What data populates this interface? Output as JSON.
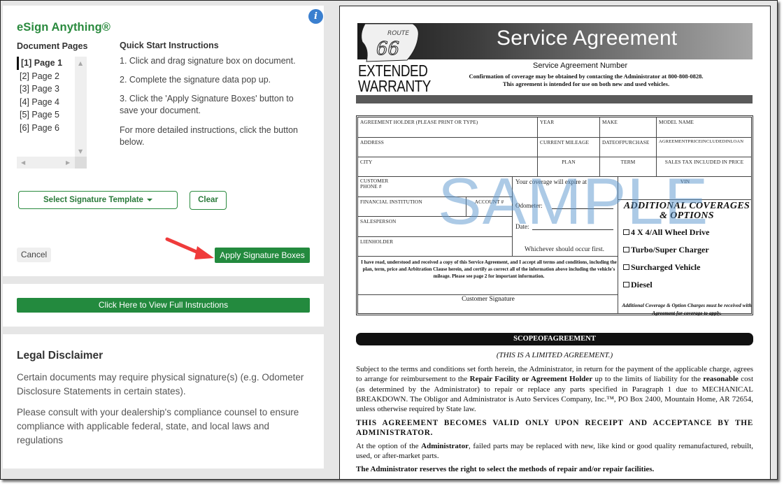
{
  "app": {
    "title": "eSign Anything®",
    "info_icon": "info-icon"
  },
  "pages": {
    "label": "Document Pages",
    "items": [
      "[1] Page 1",
      "[2] Page 2",
      "[3] Page 3",
      "[4] Page 4",
      "[5] Page 5",
      "[6] Page 6"
    ],
    "selected_index": 0
  },
  "quick_start": {
    "label": "Quick Start Instructions",
    "steps": [
      "1. Click and drag signature box on document.",
      "2. Complete the signature data pop up.",
      "3. Click the 'Apply Signature Boxes' button to save your document.",
      "For more detailed instructions, click the button below."
    ]
  },
  "buttons": {
    "select_template": "Select Signature Template",
    "clear": "Clear",
    "cancel": "Cancel",
    "apply": "Apply Signature Boxes",
    "full_instructions": "Click Here to View Full Instructions"
  },
  "legal": {
    "title": "Legal Disclaimer",
    "paragraphs": [
      "Certain documents may require physical signature(s) (e.g. Odometer Disclosure Statements in certain states).",
      "Please consult with your dealership's compliance counsel to ensure compliance with applicable federal, state, and local laws and regulations"
    ]
  },
  "colors": {
    "brand_green": "#238a3e",
    "title_green": "#2a8a3e",
    "info_blue": "#3a7fcf",
    "annotation_arrow": "#ef3b3b",
    "watermark": "#5a96cd"
  },
  "document": {
    "logo_route": "ROUTE",
    "logo_number": "66",
    "logo_line1": "EXTENDED",
    "logo_line2": "WARRANTY",
    "title": "Service Agreement",
    "number_label": "Service Agreement Number",
    "confirmation": "Confirmation of coverage may be obtained by contacting the Administrator at 800-808-0828.",
    "intended": "This agreement is intended for use on both new and used vehicles.",
    "watermark": "SAMPLE",
    "fields": {
      "holder": "AGREEMENT HOLDER (PLEASE PRINT OR TYPE)",
      "year": "YEAR",
      "make": "MAKE",
      "model": "MODEL NAME",
      "address": "ADDRESS",
      "mileage": "CURRENT MILEAGE",
      "purchase_date": "DATEOFPURCHASE",
      "price_in_loan": "AGREEMENTPRICEINCLUDEDINLOAN",
      "city": "CITY",
      "plan": "PLAN",
      "term": "TERM",
      "sales_tax": "SALES TAX INCLUDED IN PRICE",
      "phone_1": "CUSTOMER",
      "phone_2": "PHONE #",
      "financial": "FINANCIAL INSTITUTION",
      "account": "ACCOUNT #",
      "salesperson": "SALESPERSON",
      "lienholder": "LIENHOLDER",
      "vin": "VIN"
    },
    "coverage_expire": "Your coverage will expire at",
    "odometer": "Odometer:",
    "date": "Date:",
    "whichever": "Whichever should occur first.",
    "acknowledgement": "I have read, understood and received a copy of this Service Agreement, and I accept all terms and conditions, including the plan, term, price and Arbitration Clause herein, and certify as correct all of the information above including the vehicle's mileage.  Please see page 2 for important information.",
    "customer_signature": "Customer Signature",
    "additional_title": "ADDITIONAL COVERAGES & OPTIONS",
    "options": [
      "4 X 4/All Wheel Drive",
      "Turbo/Super Charger",
      "Surcharged Vehicle",
      "Diesel"
    ],
    "additional_note": "Additional Coverage & Option Charges must be received with Agreement for coverage to apply.",
    "scope_title": "SCOPEOFAGREEMENT",
    "limited": "(THIS IS A LIMITED AGREEMENT.)",
    "p1_a": "Subject to the terms and conditions set forth herein, the Administrator, in return for the payment of the applicable charge, agrees to arrange for reimbursement to the ",
    "p1_b": "Repair Facility or Agreement Holder",
    "p1_c": " up to the limits of liability for the ",
    "p1_d": "reasonable",
    "p1_e": " cost (as determined by the Administrator) to repair or replace any parts specified in Paragraph 1 due to MECHANICAL BREAKDOWN. The Obligor and Administrator is Auto Services Company, Inc.™, PO Box 2400, Mountain Home, AR  72654, unless otherwise required by State law.",
    "p2": "THIS AGREEMENT BECOMES VALID ONLY UPON RECEIPT AND ACCEPTANCE BY THE ADMINISTRATOR.",
    "p3_a": "At the option of the ",
    "p3_b": "Administrator",
    "p3_c": ", failed parts may be replaced with new, like kind or good quality remanufactured, rebuilt, used, or after-market parts.",
    "p4": "The Administrator reserves the right to select the methods of repair and/or repair facilities."
  }
}
